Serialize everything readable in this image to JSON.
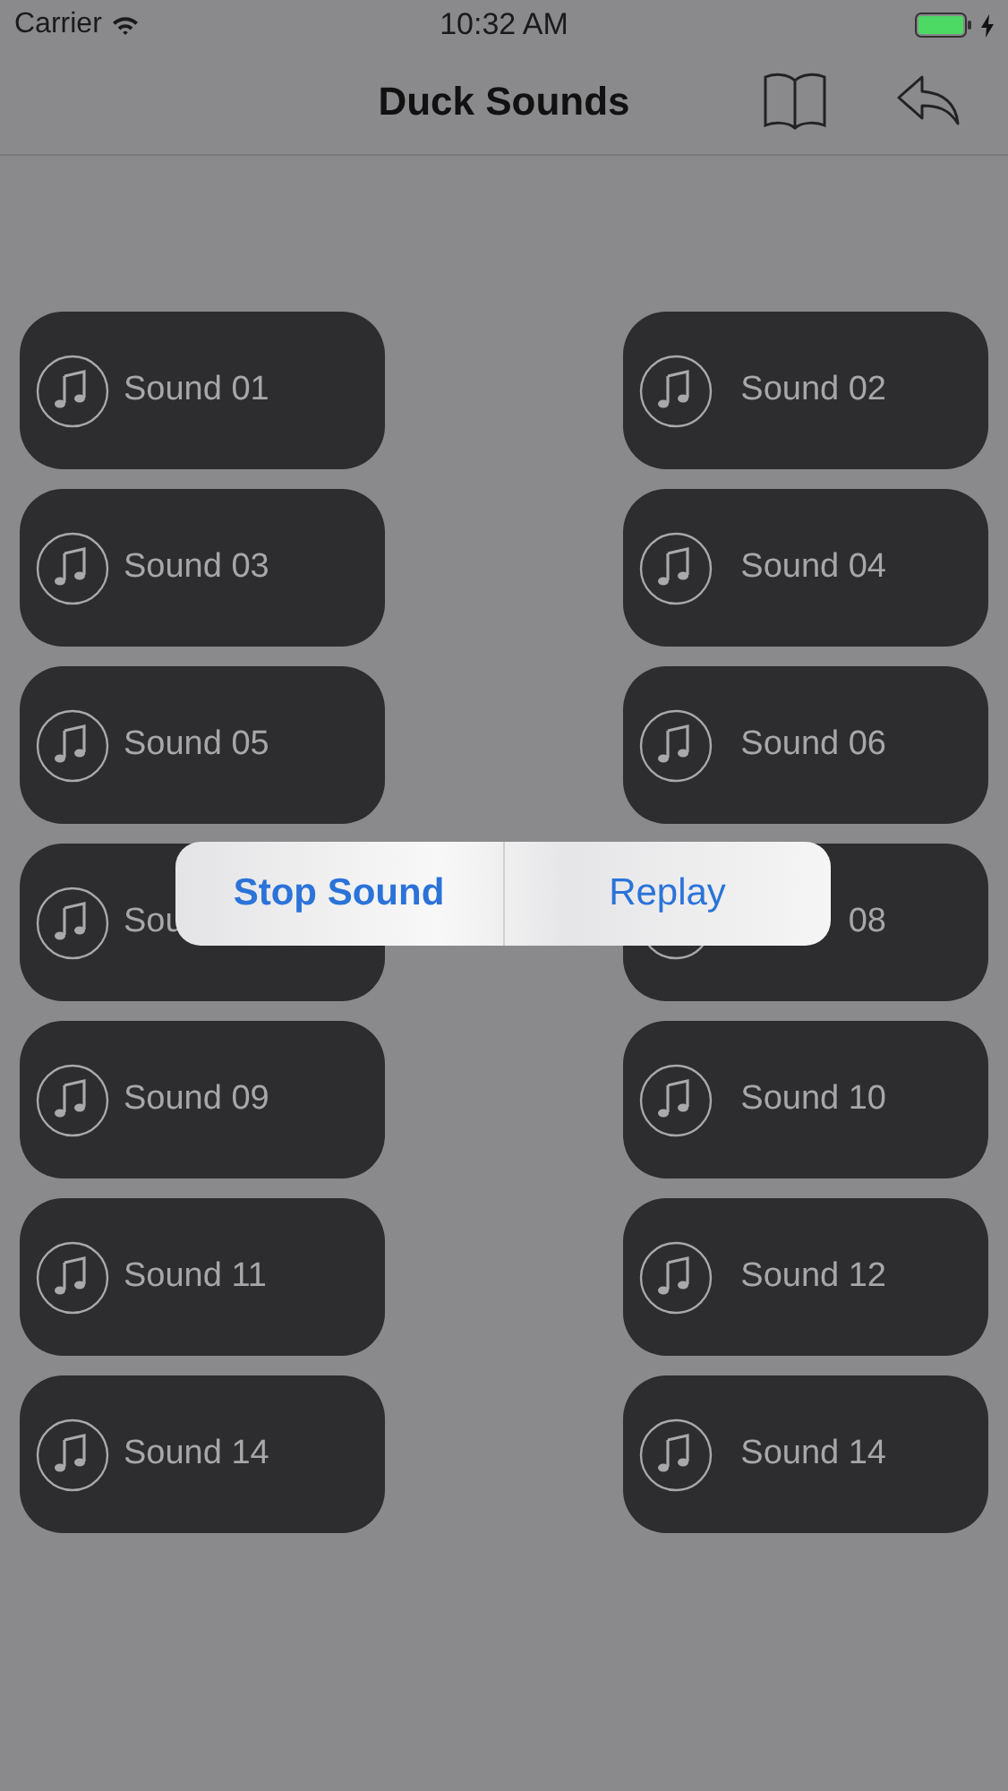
{
  "status_bar": {
    "carrier": "Carrier",
    "time": "10:32 AM"
  },
  "nav": {
    "title": "Duck Sounds"
  },
  "sounds": [
    {
      "label": "Sound 01"
    },
    {
      "label": "Sound 02"
    },
    {
      "label": "Sound 03"
    },
    {
      "label": "Sound 04"
    },
    {
      "label": "Sound 05"
    },
    {
      "label": "Sound 06"
    },
    {
      "label": "Sou"
    },
    {
      "label": "08"
    },
    {
      "label": "Sound 09"
    },
    {
      "label": "Sound 10"
    },
    {
      "label": "Sound 11"
    },
    {
      "label": "Sound 12"
    },
    {
      "label": "Sound 14"
    },
    {
      "label": "Sound 14"
    }
  ],
  "alert": {
    "actions": [
      "Stop Sound",
      "Replay"
    ]
  }
}
